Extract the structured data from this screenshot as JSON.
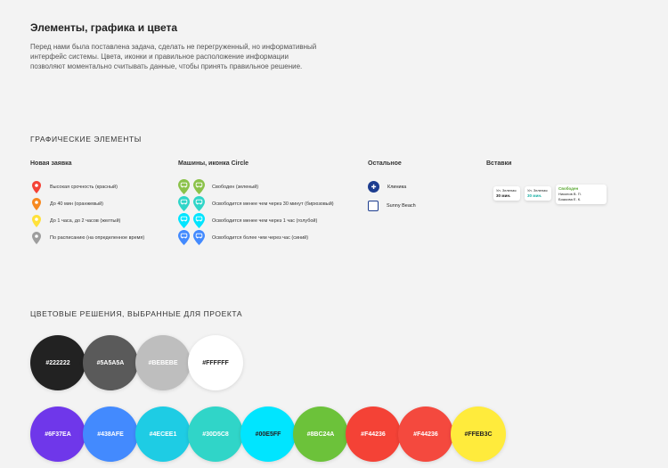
{
  "header": {
    "title": "Элементы, графика и цвета",
    "description": "Перед нами была поставлена задача, сделать не перегруженный, но информативный интерфейс системы. Цвета, иконки и правильное расположение информации позволяют моментально считывать данные, чтобы принять правильное решение."
  },
  "graphic": {
    "heading": "ГРАФИЧЕСКИЕ ЭЛЕМЕНТЫ",
    "new_request": {
      "heading": "Новая заявка",
      "items": [
        {
          "label": "Высокая срочность (красный)",
          "color": "#F44236"
        },
        {
          "label": "До 40 мин (оранжевый)",
          "color": "#F7891F"
        },
        {
          "label": "До 1 часа, до 2 часов (желтый)",
          "color": "#FFE13A"
        },
        {
          "label": "По расписанию (на определенное время)",
          "color": "#9E9E9E"
        }
      ]
    },
    "cars": {
      "heading": "Машины, иконка Circle",
      "items": [
        {
          "label": "Свободен (зеленый)",
          "color": "#8BC24A"
        },
        {
          "label": "Освободится менее чем через 30 минут (бирюзовый)",
          "color": "#30D5C8"
        },
        {
          "label": "Освободится менее чем через 1 час (голубой)",
          "color": "#00E5FF"
        },
        {
          "label": "Освободится более чем через час (синий)",
          "color": "#438AFE"
        }
      ]
    },
    "other": {
      "heading": "Остальное",
      "items": [
        {
          "label": "Клиника",
          "icon": "clinic-icon"
        },
        {
          "label": "Sunny Beach",
          "icon": "building-icon"
        }
      ]
    },
    "inserts": {
      "heading": "Вставки",
      "tip1": {
        "line1": "Ул. Зеленая",
        "line2": "30 мин."
      },
      "tip2": {
        "line1": "Ул. Зеленая",
        "line2": "30 мин."
      },
      "tip3": {
        "status": "Свободен",
        "line1": "Никонов В. П.",
        "line2": "Божкова Е. К."
      }
    }
  },
  "colors": {
    "heading": "ЦВЕТОВЫЕ РЕШЕНИЯ, ВЫБРАННЫЕ ДЛЯ ПРОЕКТА",
    "row1": [
      {
        "label": "#222222",
        "hex": "#222222",
        "text": "#ffffff"
      },
      {
        "label": "#5A5A5A",
        "hex": "#5A5A5A",
        "text": "#ffffff"
      },
      {
        "label": "#BEBEBE",
        "hex": "#BEBEBE",
        "text": "#ffffff"
      },
      {
        "label": "#FFFFFF",
        "hex": "#FFFFFF",
        "text": "#222222"
      }
    ],
    "row2": [
      {
        "label": "#6F37EA",
        "hex": "#6F37EA",
        "text": "#ffffff"
      },
      {
        "label": "#438AFE",
        "hex": "#438AFE",
        "text": "#ffffff"
      },
      {
        "label": "#4ECEE1",
        "hex": "#1ECCE4",
        "text": "#ffffff"
      },
      {
        "label": "#30D5C8",
        "hex": "#30D5C8",
        "text": "#ffffff"
      },
      {
        "label": "#00E5FF",
        "hex": "#00E5FF",
        "text": "#222222"
      },
      {
        "label": "#8BC24A",
        "hex": "#6CC23A",
        "text": "#ffffff"
      },
      {
        "label": "#F44236",
        "hex": "#F44236",
        "text": "#ffffff"
      },
      {
        "label": "#F44236",
        "hex": "#F4493E",
        "text": "#ffffff"
      },
      {
        "label": "#FFEB3C",
        "hex": "#FFEB3C",
        "text": "#222222"
      }
    ]
  }
}
